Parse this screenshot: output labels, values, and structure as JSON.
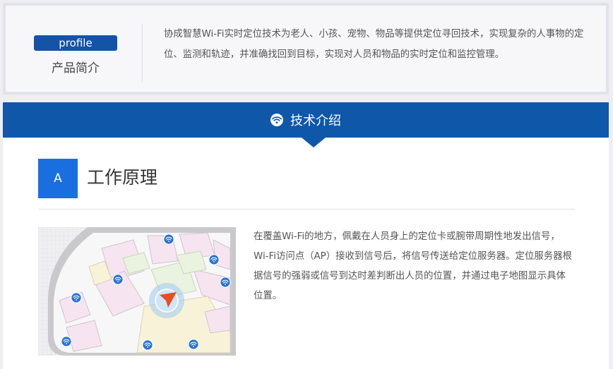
{
  "profile": {
    "tag": "profile",
    "title": "产品简介",
    "description": "协成智慧Wi-Fi实时定位技术为老人、小孩、宠物、物品等提供定位寻回技术，实现复杂的人事物的定位、监测和轨迹，并准确找回到目标，实现对人员和物品的实时定位和监控管理。"
  },
  "tech": {
    "header_title": "技术介绍",
    "header_icon": "wifi-icon"
  },
  "principle": {
    "badge": "A",
    "title": "工作原理",
    "description": "在覆盖Wi-Fi的地方，佩戴在人员身上的定位卡或腕带周期性地发出信号，Wi-Fi访问点（AP）接收到信号后，将信号传送给定位服务器。定位服务器根据信号的强弱或信号到达时差判断出人员的位置，并通过电子地图显示具体位置。"
  },
  "colors": {
    "brand_blue": "#0e57a9",
    "badge_blue": "#1a6fe0",
    "wifi_marker": "#2a72d2",
    "location_arrow": "#e94e1f"
  }
}
